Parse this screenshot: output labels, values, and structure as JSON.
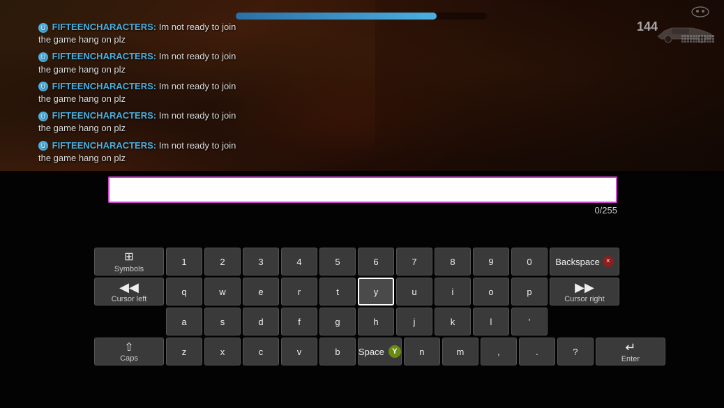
{
  "game": {
    "progressBar": 80,
    "hudNumber": "144",
    "chatMessages": [
      {
        "username": "FIFTEENCHARACTERS:",
        "text": "Im not ready to join the game hang on plz"
      },
      {
        "username": "FIFTEENCHARACTERS:",
        "text": "Im not ready to join the game hang on plz"
      },
      {
        "username": "FIFTEENCHARACTERS:",
        "text": "Im not ready to join the game hang on plz"
      },
      {
        "username": "FIFTEENCHARACTERS:",
        "text": "Im not ready to join the game hang on plz"
      },
      {
        "username": "FIFTEENCHARACTERS:",
        "text": "Im not ready to join the game hang on plz"
      }
    ]
  },
  "textInput": {
    "value": "",
    "placeholder": "",
    "charCount": "0/255"
  },
  "keyboard": {
    "rows": [
      {
        "keys": [
          {
            "id": "symbols",
            "label": "Symbols",
            "icon": "⊞",
            "type": "wide-left"
          },
          {
            "id": "1",
            "label": "1",
            "type": "normal"
          },
          {
            "id": "2",
            "label": "2",
            "type": "normal"
          },
          {
            "id": "3",
            "label": "3",
            "type": "normal"
          },
          {
            "id": "4",
            "label": "4",
            "type": "normal"
          },
          {
            "id": "5",
            "label": "5",
            "type": "normal"
          },
          {
            "id": "6",
            "label": "6",
            "type": "normal"
          },
          {
            "id": "7",
            "label": "7",
            "type": "normal"
          },
          {
            "id": "8",
            "label": "8",
            "type": "normal"
          },
          {
            "id": "9",
            "label": "9",
            "type": "normal"
          },
          {
            "id": "0",
            "label": "0",
            "type": "normal"
          },
          {
            "id": "backspace",
            "label": "Backspace",
            "icon": "⌫",
            "badge": "×",
            "type": "wide-right"
          }
        ]
      },
      {
        "keys": [
          {
            "id": "cursor-left",
            "label": "Cursor left",
            "icon": "⬅",
            "type": "wide-left"
          },
          {
            "id": "q",
            "label": "q",
            "type": "normal"
          },
          {
            "id": "w",
            "label": "w",
            "type": "normal"
          },
          {
            "id": "e",
            "label": "e",
            "type": "normal"
          },
          {
            "id": "r",
            "label": "r",
            "type": "normal"
          },
          {
            "id": "t",
            "label": "t",
            "type": "normal"
          },
          {
            "id": "y",
            "label": "y",
            "type": "normal",
            "selected": true
          },
          {
            "id": "u",
            "label": "u",
            "type": "normal"
          },
          {
            "id": "i",
            "label": "i",
            "type": "normal"
          },
          {
            "id": "o",
            "label": "o",
            "type": "normal"
          },
          {
            "id": "p",
            "label": "p",
            "type": "normal"
          },
          {
            "id": "cursor-right",
            "label": "Cursor right",
            "icon": "➡",
            "type": "wide-right"
          }
        ]
      },
      {
        "keys": [
          {
            "id": "dummy1",
            "label": "",
            "type": "wide-left",
            "transparent": true
          },
          {
            "id": "a",
            "label": "a",
            "type": "normal"
          },
          {
            "id": "s",
            "label": "s",
            "type": "normal"
          },
          {
            "id": "d",
            "label": "d",
            "type": "normal"
          },
          {
            "id": "f",
            "label": "f",
            "type": "normal"
          },
          {
            "id": "g",
            "label": "g",
            "type": "normal"
          },
          {
            "id": "h",
            "label": "h",
            "type": "normal"
          },
          {
            "id": "j",
            "label": "j",
            "type": "normal"
          },
          {
            "id": "k",
            "label": "k",
            "type": "normal"
          },
          {
            "id": "l",
            "label": "l",
            "type": "normal"
          },
          {
            "id": "apos",
            "label": "'",
            "type": "normal"
          },
          {
            "id": "dummy2",
            "label": "",
            "type": "wide-right",
            "transparent": true
          }
        ]
      },
      {
        "keys": [
          {
            "id": "caps",
            "label": "Caps",
            "icon": "⇧",
            "type": "wide-left"
          },
          {
            "id": "z",
            "label": "z",
            "type": "normal"
          },
          {
            "id": "x",
            "label": "x",
            "type": "normal"
          },
          {
            "id": "c",
            "label": "c",
            "type": "normal"
          },
          {
            "id": "v",
            "label": "v",
            "type": "normal"
          },
          {
            "id": "b",
            "label": "b",
            "type": "normal"
          },
          {
            "id": "n",
            "label": "n",
            "type": "normal"
          },
          {
            "id": "m",
            "label": "m",
            "type": "normal"
          },
          {
            "id": "comma",
            "label": ",",
            "type": "normal"
          },
          {
            "id": "period",
            "label": ".",
            "type": "normal"
          },
          {
            "id": "question",
            "label": "?",
            "type": "normal"
          },
          {
            "id": "enter",
            "label": "Enter",
            "icon": "↵",
            "type": "wide-right"
          }
        ]
      }
    ],
    "spaceLabel": "Space",
    "spaceBadge": "Y"
  }
}
